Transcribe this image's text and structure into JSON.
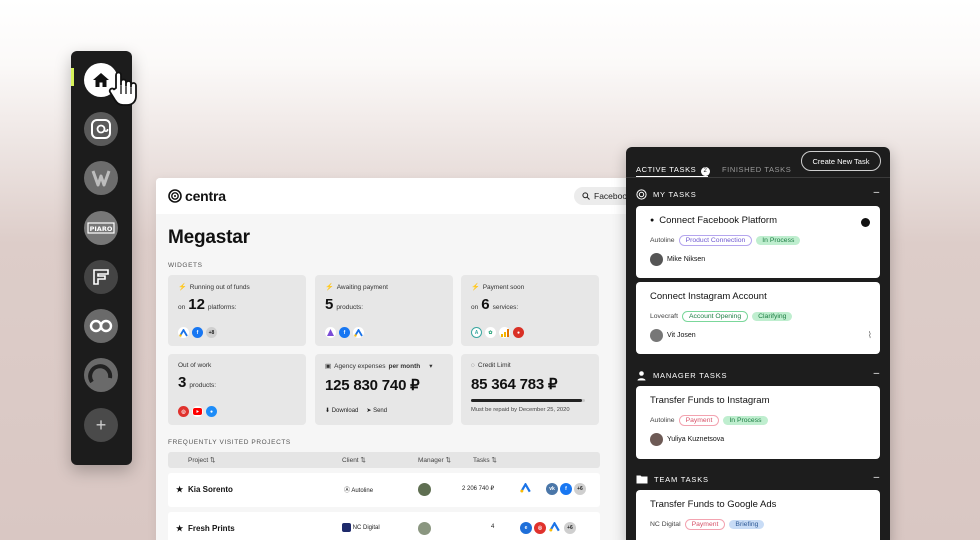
{
  "sidebar": {
    "items": [
      {
        "name": "home",
        "icon": "home-icon",
        "active": true
      },
      {
        "name": "at",
        "icon": "at-sign-icon"
      },
      {
        "name": "w-brand",
        "icon": "w-logo-icon"
      },
      {
        "name": "piaro",
        "icon": "piaro-logo-icon",
        "label": "PIARO"
      },
      {
        "name": "frame-brand",
        "icon": "f-logo-icon"
      },
      {
        "name": "oo-brand",
        "icon": "oo-logo-icon"
      },
      {
        "name": "arc-brand",
        "icon": "arc-logo-icon"
      },
      {
        "name": "add",
        "icon": "plus-icon",
        "label": "+"
      }
    ],
    "accent": "#d6f25a"
  },
  "main": {
    "logo": "centra",
    "search_value": "Facebook",
    "title": "Megastar",
    "widgets_label": "WIDGETS",
    "widgets": [
      {
        "head": "Running out of funds",
        "prefix": "on",
        "num": "12",
        "suffix": "platforms:",
        "icons": [
          "google-ads",
          "facebook"
        ],
        "extra": "+8"
      },
      {
        "head": "Awaiting payment",
        "prefix": "",
        "num": "5",
        "suffix": "products:",
        "icons": [
          "purple-app",
          "facebook",
          "google-ads"
        ],
        "extra": ""
      },
      {
        "head": "Payment soon",
        "prefix": "on",
        "num": "6",
        "suffix": "services:",
        "icons": [
          "teal-app",
          "green-app",
          "bars-app",
          "red-app"
        ],
        "extra": ""
      },
      {
        "head": "Out of work",
        "prefix": "",
        "num": "3",
        "suffix": "products:",
        "icons": [
          "target-app",
          "youtube",
          "blue-app"
        ],
        "extra": ""
      },
      {
        "head": "Agency expenses",
        "head_bold": "per month",
        "big": "125 830 740 ₽",
        "actions": [
          "Download",
          "Send"
        ]
      },
      {
        "head": "Credit Limit",
        "big": "85 364 783 ₽",
        "progress": 0.97,
        "note": "Must be repaid by December 25, 2020"
      }
    ],
    "projects_label": "FREQUENTLY VISITED PROJECTS",
    "columns": [
      "Project ⇅",
      "Client ⇅",
      "Manager ⇅",
      "Tasks ⇅"
    ],
    "rows": [
      {
        "project": "Kia Sorento",
        "client": "Autoline",
        "tasks": "2 206 740 ₽",
        "extra": "+6"
      },
      {
        "project": "Fresh Prints",
        "client": "NC Digital",
        "tasks": "4",
        "extra": "+6"
      }
    ]
  },
  "tasks": {
    "tab_active": "ACTIVE TASKS",
    "tab_active_count": "2",
    "tab_inactive": "FINISHED TASKS",
    "create_label": "Create New Task",
    "groups": [
      {
        "title": "MY TASKS",
        "cards": [
          {
            "title": "Connect Facebook Platform",
            "client": "Autoline",
            "tags": [
              "Product Connection",
              "In Process"
            ],
            "person": "Mike Niksen"
          },
          {
            "title": "Connect Instagram Account",
            "client": "Lovecraft",
            "tags": [
              "Account Opening",
              "Clarifying"
            ],
            "person": "Vit Josen"
          }
        ]
      },
      {
        "title": "MANAGER TASKS",
        "cards": [
          {
            "title": "Transfer Funds to Instagram",
            "client": "Autoline",
            "tags": [
              "Payment",
              "In Process"
            ],
            "person": "Yuliya Kuznetsova"
          }
        ]
      },
      {
        "title": "TEAM TASKS",
        "cards": [
          {
            "title": "Transfer Funds to Google Ads",
            "client": "NC Digital",
            "tags": [
              "Payment",
              "Briefing"
            ],
            "person": ""
          }
        ]
      }
    ],
    "minus": "–"
  }
}
